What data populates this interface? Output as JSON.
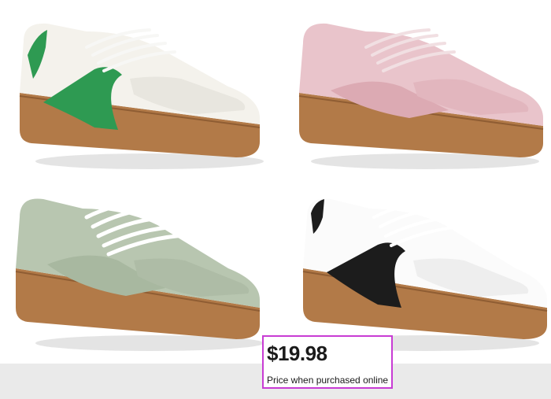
{
  "products": [
    {
      "name": "shoe-white-green",
      "upper": "#f4f2ec",
      "accent": "#2e9a52",
      "lace": "#f7f7f5",
      "sole": "#b27a48"
    },
    {
      "name": "shoe-pink",
      "upper": "#e9c4cb",
      "accent": "#dcaab3",
      "lace": "#f1dfe2",
      "sole": "#b27a48"
    },
    {
      "name": "shoe-sage",
      "upper": "#b8c6b0",
      "accent": "#a8b8a0",
      "lace": "#ffffff",
      "sole": "#b27a48"
    },
    {
      "name": "shoe-white-black",
      "upper": "#fbfbfb",
      "accent": "#1c1c1c",
      "lace": "#ffffff",
      "sole": "#b27a48"
    }
  ],
  "price": {
    "amount": "$19.98",
    "note": "Price when purchased online",
    "highlight_color": "#c83cd4"
  }
}
